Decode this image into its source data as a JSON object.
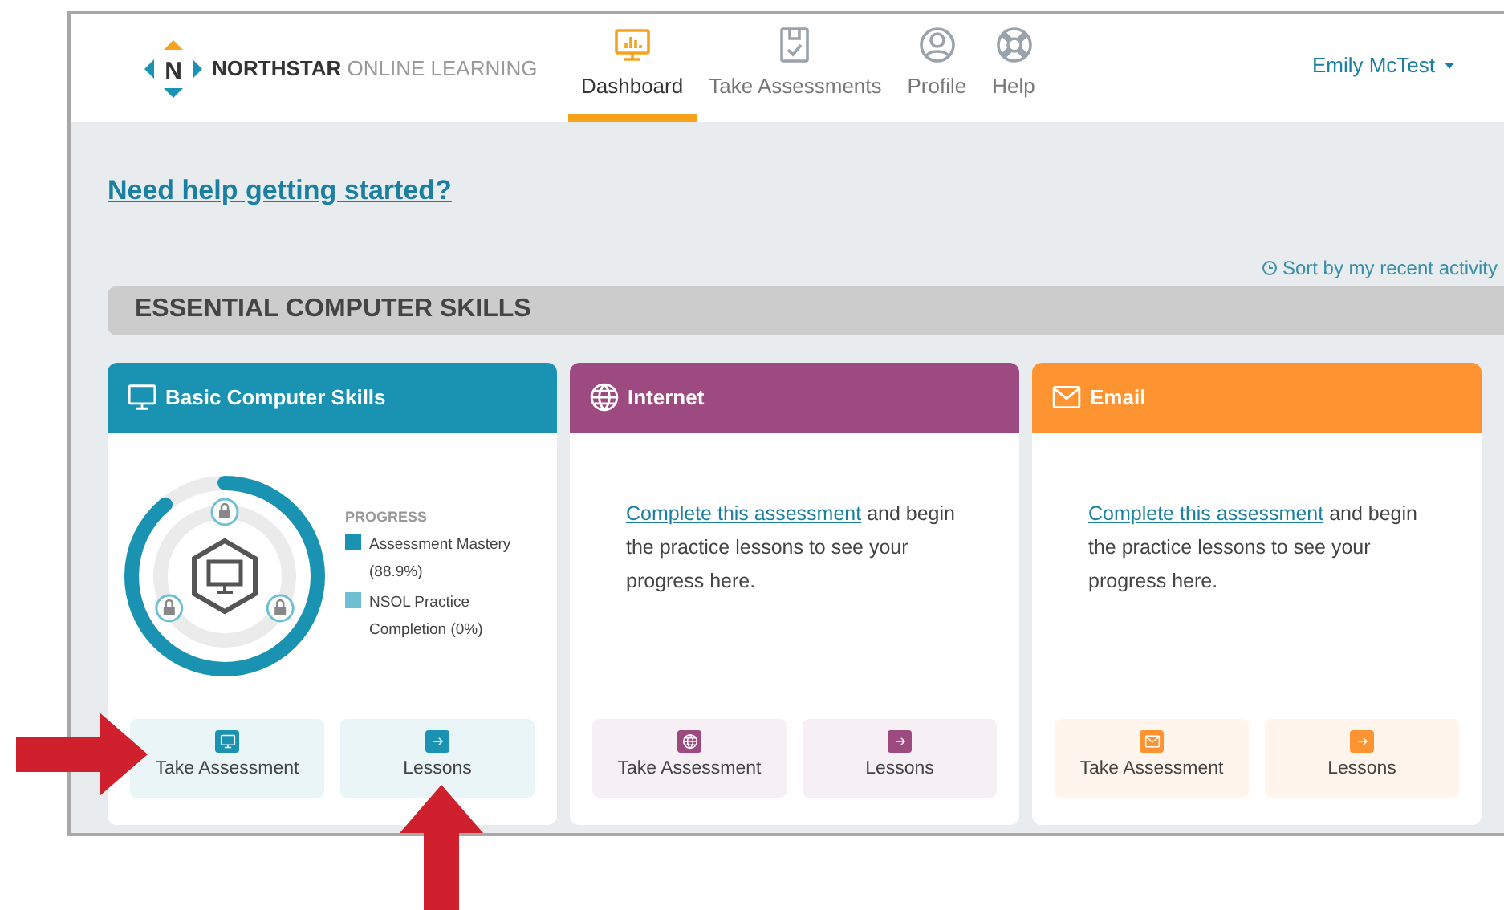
{
  "brand": {
    "logo_letter": "N",
    "name_bold": "NORTHSTAR",
    "name_light": "ONLINE LEARNING"
  },
  "nav": [
    {
      "label": "Dashboard",
      "selected": true
    },
    {
      "label": "Take Assessments",
      "selected": false
    },
    {
      "label": "Profile",
      "selected": false
    },
    {
      "label": "Help",
      "selected": false
    }
  ],
  "user_menu": {
    "label": "Emily McTest"
  },
  "help_link": "Need help getting started?",
  "sort_link": "Sort by my recent activity",
  "section": {
    "title": "ESSENTIAL COMPUTER SKILLS",
    "cards": [
      {
        "title": "Basic Computer Skills",
        "color": "#1a93b3",
        "kind": "progress",
        "progress": {
          "heading": "PROGRESS",
          "legend": [
            {
              "label": "Assessment Mastery (88.9%)",
              "color": "#1a93b3",
              "level": 0.889
            },
            {
              "label": "NSOL Practice Completion (0%)",
              "color": "#6fbfd3",
              "level": 0
            }
          ]
        },
        "buttons": [
          {
            "label": "Take Assessment"
          },
          {
            "label": "Lessons"
          }
        ]
      },
      {
        "title": "Internet",
        "color": "#9c4a80",
        "kind": "prompt",
        "prompt": {
          "link": "Complete this assessment",
          "text": " and begin the practice lessons to see your progress here."
        },
        "buttons": [
          {
            "label": "Take Assessment"
          },
          {
            "label": "Lessons"
          }
        ]
      },
      {
        "title": "Email",
        "color": "#fd9431",
        "kind": "prompt",
        "prompt": {
          "link": "Complete this assessment",
          "text": " and begin the practice lessons to see your progress here."
        },
        "buttons": [
          {
            "label": "Take Assessment"
          },
          {
            "label": "Lessons"
          }
        ]
      }
    ]
  }
}
